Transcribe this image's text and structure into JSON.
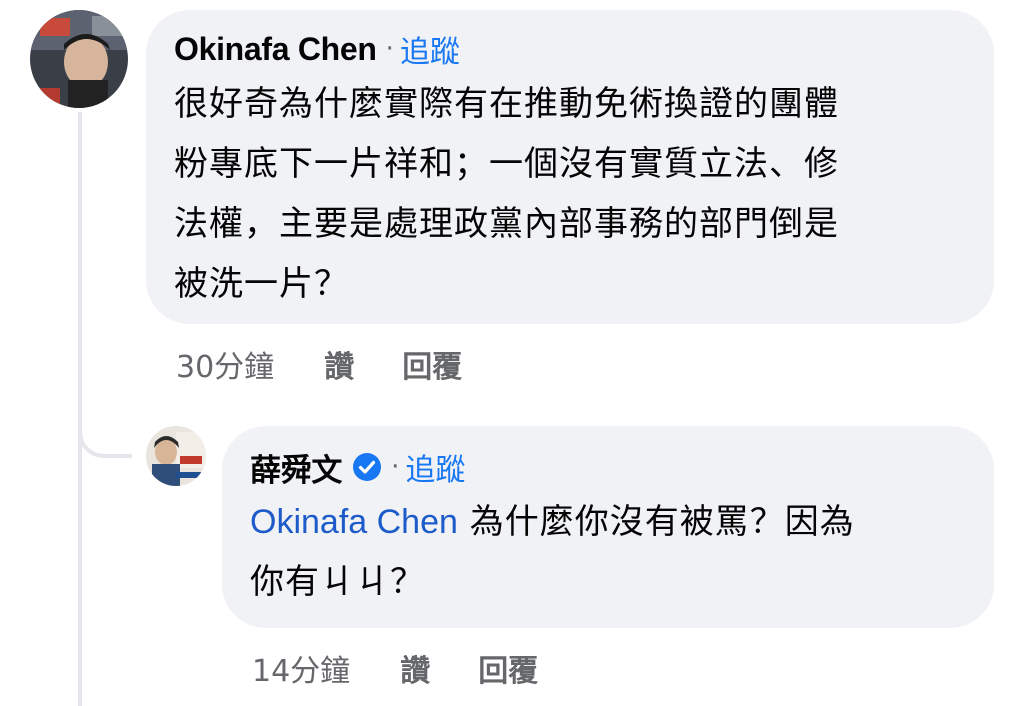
{
  "comment": {
    "author": "Okinafa Chen",
    "separator": "·",
    "follow_label": "追蹤",
    "body_lines": [
      "很好奇為什麼實際有在推動免術換證的團體",
      "粉專底下一片祥和；一個沒有實質立法、修",
      "法權，主要是處理政黨內部事務的部門倒是",
      "被洗一片？"
    ],
    "timestamp": "30分鐘",
    "like_label": "讚",
    "reply_label": "回覆"
  },
  "reply": {
    "author": "薛舜文",
    "separator": "·",
    "follow_label": "追蹤",
    "mention": "Okinafa Chen",
    "body_line1_rest": " 為什麼你沒有被罵？因為",
    "body_line2": "你有ㄐㄐ？",
    "timestamp": "14分鐘",
    "like_label": "讚",
    "reply_label": "回覆",
    "verified_icon_color": "#1877f2"
  },
  "colors": {
    "bubble_bg": "#f0f2f5",
    "link_blue": "#1877f2",
    "mention_blue": "#1c5bc9",
    "meta_gray": "#65676b"
  }
}
